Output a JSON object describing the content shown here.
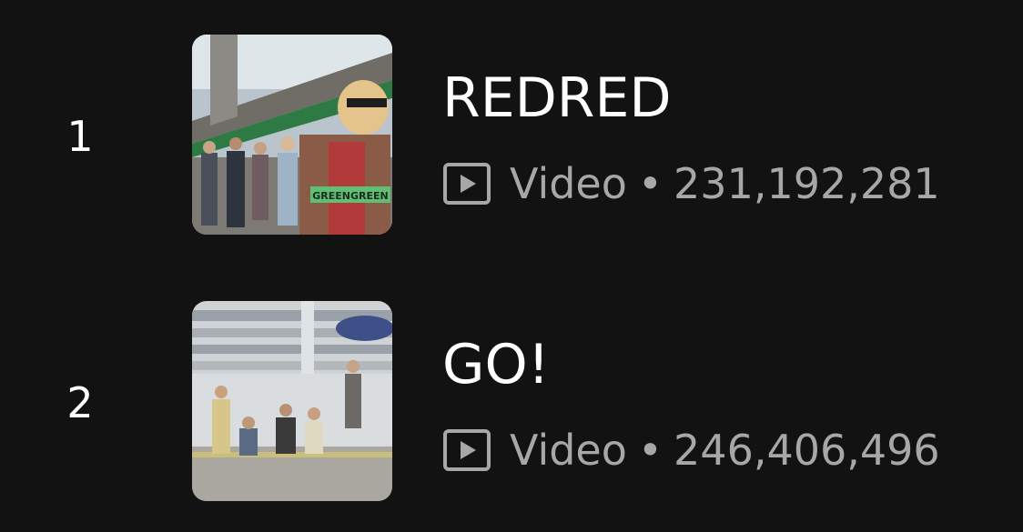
{
  "tracks": [
    {
      "rank": "1",
      "title": "REDRED",
      "type_label": "Video",
      "separator": "•",
      "views": "231,192,281",
      "cover_text": "GREENGREEN",
      "icon": "video-play-icon"
    },
    {
      "rank": "2",
      "title": "GO!",
      "type_label": "Video",
      "separator": "•",
      "views": "246,406,496",
      "icon": "video-play-icon"
    }
  ],
  "colors": {
    "background": "#121212",
    "primary_text": "#ffffff",
    "secondary_text": "#a7a7a7",
    "cover_label_bg": "#5fbf72"
  }
}
